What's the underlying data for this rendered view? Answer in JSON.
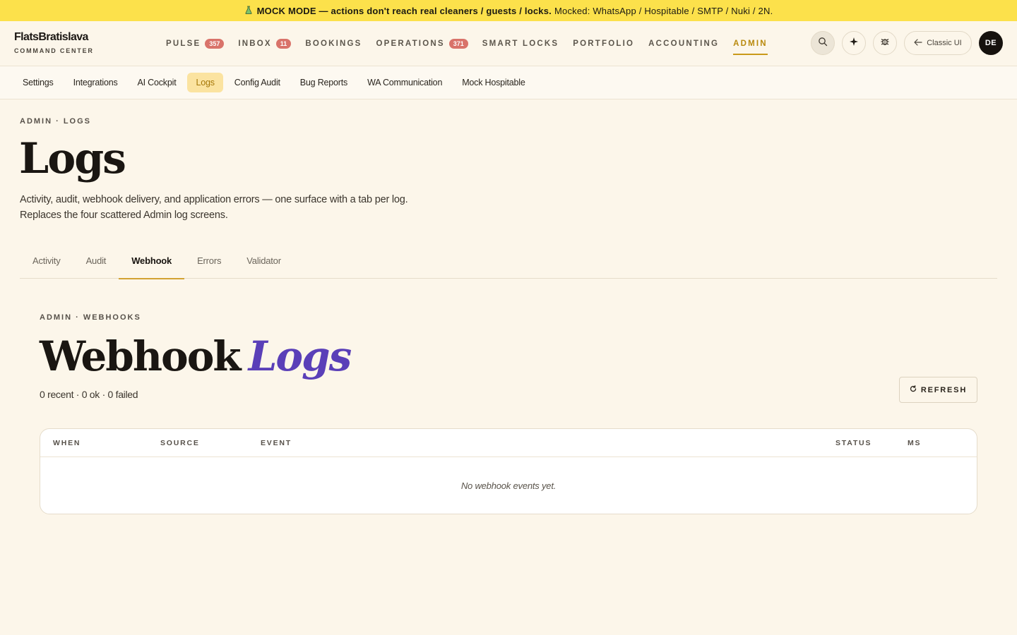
{
  "banner": {
    "icon": "flask-icon",
    "strong": "MOCK MODE — actions don't reach real cleaners / guests / locks.",
    "rest": "Mocked: WhatsApp / Hospitable / SMTP / Nuki / 2N."
  },
  "brand": {
    "name": "FlatsBratislava",
    "subtitle": "COMMAND CENTER"
  },
  "nav": {
    "items": [
      {
        "label": "PULSE",
        "badge": "357"
      },
      {
        "label": "INBOX",
        "badge": "11"
      },
      {
        "label": "BOOKINGS"
      },
      {
        "label": "OPERATIONS",
        "badge": "371"
      },
      {
        "label": "SMART LOCKS"
      },
      {
        "label": "PORTFOLIO"
      },
      {
        "label": "ACCOUNTING"
      },
      {
        "label": "ADMIN",
        "active": true
      }
    ],
    "accent_color": "#b98a0e"
  },
  "header_actions": {
    "classic_label": "Classic UI",
    "avatar_initials": "DE"
  },
  "subnav": {
    "items": [
      "Settings",
      "Integrations",
      "AI Cockpit",
      "Logs",
      "Config Audit",
      "Bug Reports",
      "WA Communication",
      "Mock Hospitable"
    ],
    "active_index": 3
  },
  "page": {
    "breadcrumb": "ADMIN · LOGS",
    "title": "Logs",
    "description_line1": "Activity, audit, webhook delivery, and application errors — one surface with a tab per log.",
    "description_line2": "Replaces the four scattered Admin log screens."
  },
  "tabs": {
    "items": [
      "Activity",
      "Audit",
      "Webhook",
      "Errors",
      "Validator"
    ],
    "active_index": 2
  },
  "webhook": {
    "breadcrumb": "ADMIN · WEBHOOKS",
    "title_main": "Webhook",
    "title_accent": "Logs",
    "counts": "0 recent · 0 ok · 0 failed",
    "refresh_label": "REFRESH",
    "accent_color": "#5a3fb8"
  },
  "table": {
    "columns": [
      "WHEN",
      "SOURCE",
      "EVENT",
      "STATUS",
      "MS"
    ],
    "empty_text": "No webhook events yet."
  }
}
